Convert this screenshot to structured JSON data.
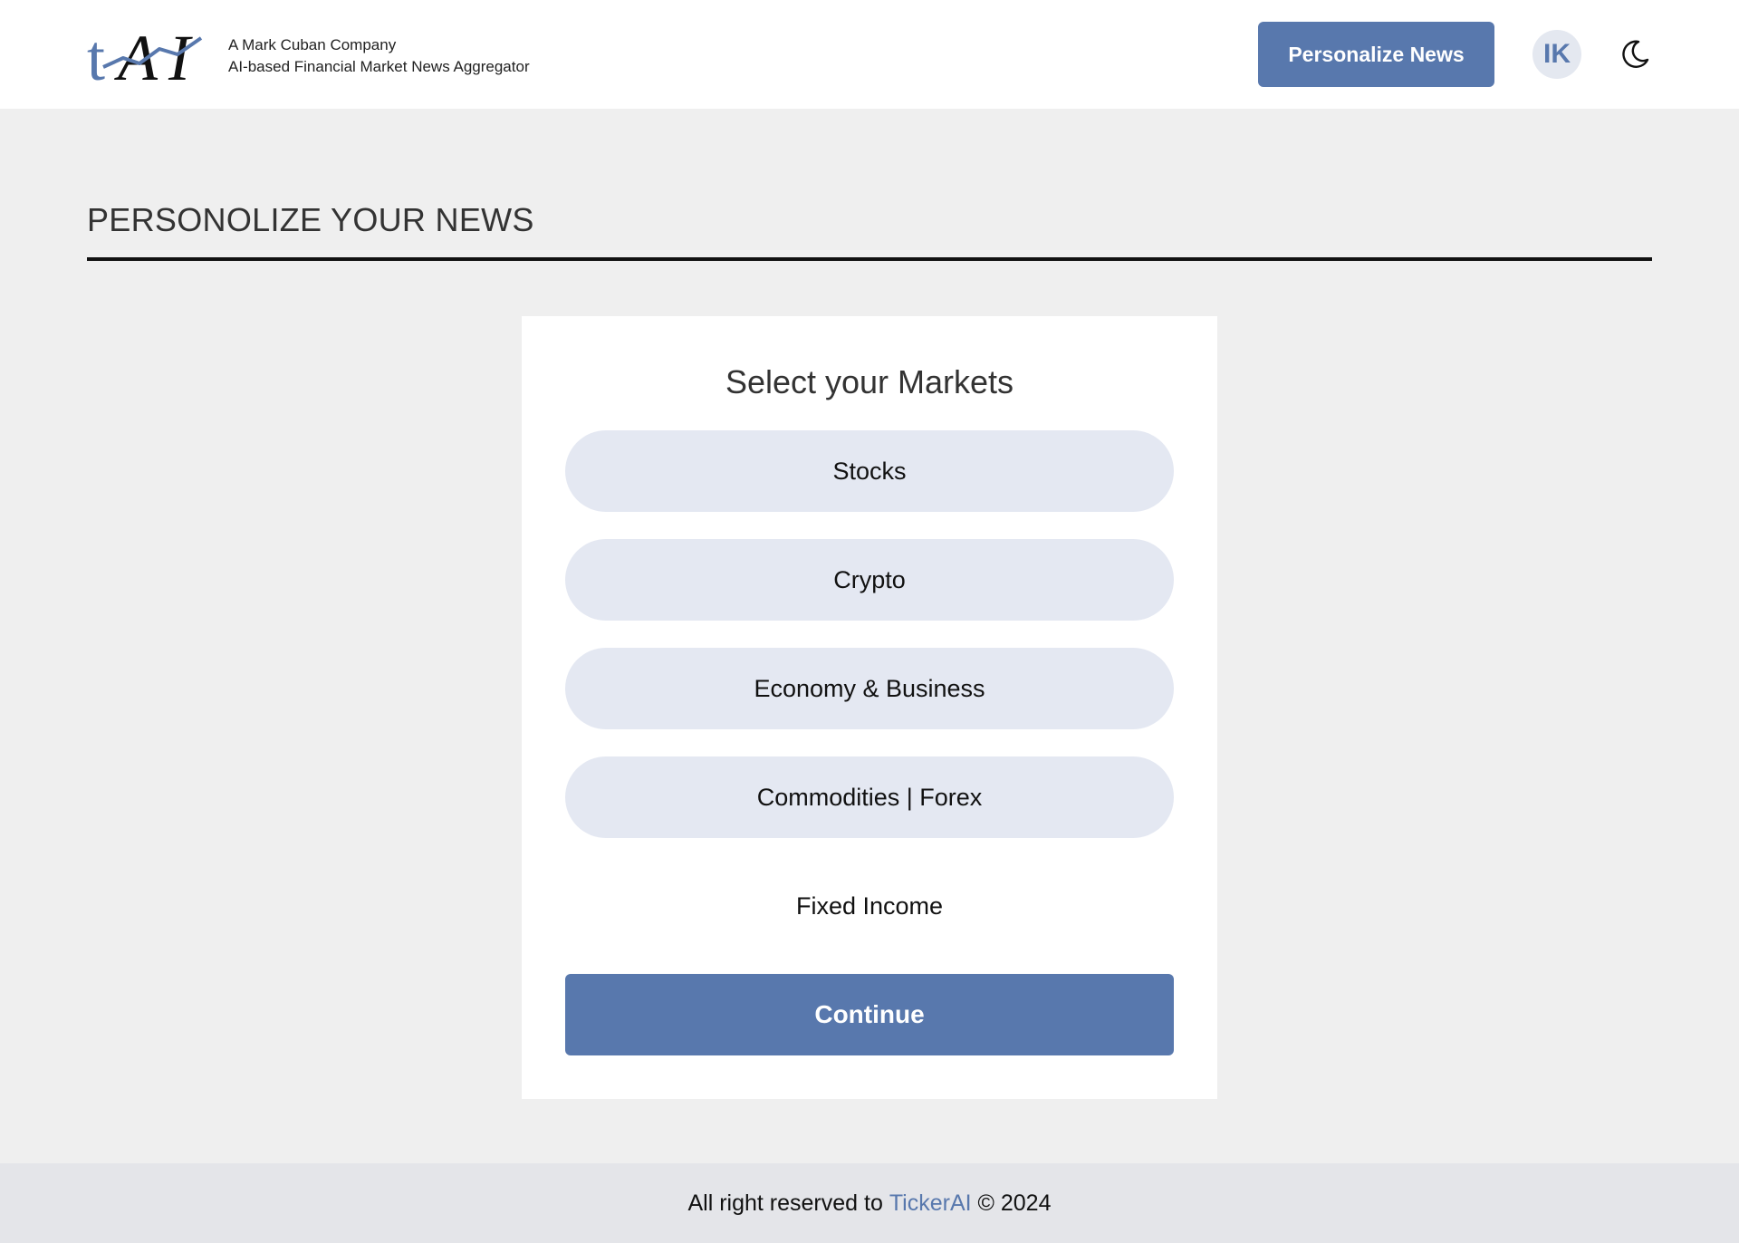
{
  "header": {
    "logo_text": "tAI",
    "tagline_line1": "A Mark Cuban Company",
    "tagline_line2": "AI-based Financial Market News Aggregator",
    "personalize_label": "Personalize News",
    "avatar_initials": "IK",
    "theme_icon": "moon-icon"
  },
  "page": {
    "title": "PERSONOLIZE YOUR NEWS"
  },
  "card": {
    "title": "Select your Markets",
    "options": [
      {
        "label": "Stocks",
        "selected": true
      },
      {
        "label": "Crypto",
        "selected": true
      },
      {
        "label": "Economy & Business",
        "selected": true
      },
      {
        "label": "Commodities | Forex",
        "selected": true
      },
      {
        "label": "Fixed Income",
        "selected": false
      }
    ],
    "continue_label": "Continue"
  },
  "footer": {
    "prefix": "All right reserved to ",
    "brand": "TickerAI",
    "suffix": " © 2024"
  },
  "colors": {
    "accent": "#5878ad",
    "option_selected_bg": "#e4e8f2",
    "page_bg": "#efefef",
    "footer_bg": "#e4e5e9"
  }
}
